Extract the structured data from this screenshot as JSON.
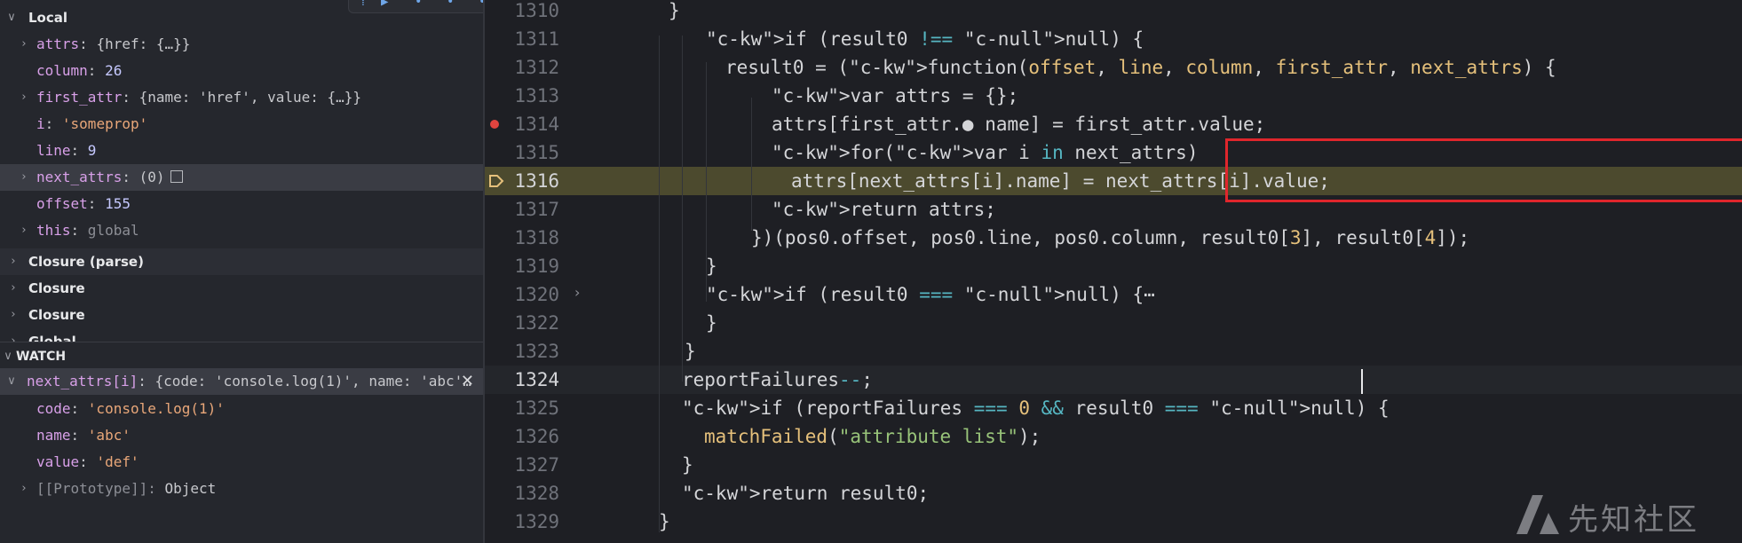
{
  "debug": {
    "local_header": "Local",
    "variables": [
      {
        "name": "attrs",
        "sep": ": ",
        "value": "{href: {…}}",
        "expandable": true
      },
      {
        "name": "column",
        "sep": ": ",
        "value": "26",
        "expandable": false
      },
      {
        "name": "first_attr",
        "sep": ": ",
        "value": "{name: 'href', value: {…}}",
        "expandable": true
      },
      {
        "name": "i",
        "sep": ": ",
        "value": "'someprop'",
        "expandable": false
      },
      {
        "name": "line",
        "sep": ": ",
        "value": "9",
        "expandable": false
      },
      {
        "name": "next_attrs",
        "sep": ": ",
        "value": "(0)",
        "expandable": true
      },
      {
        "name": "offset",
        "sep": ": ",
        "value": "155",
        "expandable": false
      },
      {
        "name": "this",
        "sep": ": ",
        "value": "global",
        "expandable": true
      }
    ],
    "scopes": [
      "Closure (parse)",
      "Closure",
      "Closure",
      "Global"
    ],
    "watch_header": "WATCH",
    "watch_expr": {
      "name": "next_attrs[i]",
      "sep": ": ",
      "value": "{code: 'console.log(1)', name: 'abc'…"
    },
    "watch_children": [
      {
        "name": "code",
        "sep": ": ",
        "value": "'console.log(1)'"
      },
      {
        "name": "name",
        "sep": ": ",
        "value": "'abc'"
      },
      {
        "name": "value",
        "sep": ": ",
        "value": "'def'"
      },
      {
        "name": "[[Prototype]]",
        "sep": ": ",
        "value": "Object"
      }
    ]
  },
  "editor": {
    "lines": [
      {
        "n": "1310",
        "text": "}"
      },
      {
        "n": "1311",
        "text": "if (result0 !== null) {"
      },
      {
        "n": "1312",
        "text": "result0 = (function(offset, line, column, first_attr, next_attrs) {"
      },
      {
        "n": "1313",
        "text": "var attrs = {};"
      },
      {
        "n": "1314",
        "text": "attrs[first_attr.● name] = first_attr.value;"
      },
      {
        "n": "1315",
        "text": "for(var i in next_attrs)"
      },
      {
        "n": "1316",
        "text": "attrs[next_attrs[i].name] = next_attrs[i].value;"
      },
      {
        "n": "1317",
        "text": "return attrs;"
      },
      {
        "n": "1318",
        "text": "})(pos0.offset, pos0.line, pos0.column, result0[3], result0[4]);"
      },
      {
        "n": "1319",
        "text": "}"
      },
      {
        "n": "1320",
        "text": "if (result0 === null) {⋯"
      },
      {
        "n": "1322",
        "text": "}"
      },
      {
        "n": "1323",
        "text": "}"
      },
      {
        "n": "1324",
        "text": "reportFailures--;"
      },
      {
        "n": "1325",
        "text": "if (reportFailures === 0 && result0 === null) {"
      },
      {
        "n": "1326",
        "text": "matchFailed(\"attribute list\");"
      },
      {
        "n": "1327",
        "text": "}"
      },
      {
        "n": "1328",
        "text": "return result0;"
      },
      {
        "n": "1329",
        "text": "}"
      }
    ],
    "watermark": "先知社区"
  },
  "colors": {
    "highlight_line": "#4c4a2e",
    "highlight_box": "#e0262c",
    "breakpoint": "#e0443f",
    "paused_arrow": "#e5c07b"
  }
}
